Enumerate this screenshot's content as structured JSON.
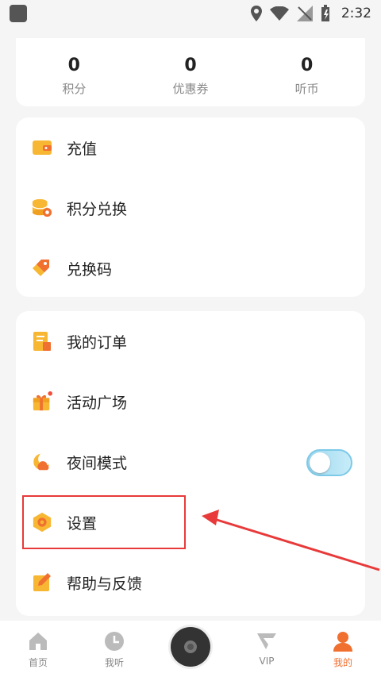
{
  "status_bar": {
    "time": "2:32"
  },
  "stats": [
    {
      "value": "0",
      "label": "积分"
    },
    {
      "value": "0",
      "label": "优惠券"
    },
    {
      "value": "0",
      "label": "听币"
    }
  ],
  "menu_group_1": [
    {
      "label": "充值",
      "icon": "wallet-icon"
    },
    {
      "label": "积分兑换",
      "icon": "coins-icon"
    },
    {
      "label": "兑换码",
      "icon": "tag-icon"
    }
  ],
  "menu_group_2": [
    {
      "label": "我的订单",
      "icon": "order-icon"
    },
    {
      "label": "活动广场",
      "icon": "gift-icon"
    },
    {
      "label": "夜间模式",
      "icon": "moon-icon"
    },
    {
      "label": "设置",
      "icon": "settings-icon"
    },
    {
      "label": "帮助与反馈",
      "icon": "edit-icon"
    }
  ],
  "night_mode": {
    "enabled": false
  },
  "bottom_nav": [
    {
      "label": "首页",
      "icon": "home-icon"
    },
    {
      "label": "我听",
      "icon": "clock-icon"
    },
    {
      "label": "",
      "icon": "disc-icon"
    },
    {
      "label": "VIP",
      "icon": "vip-icon"
    },
    {
      "label": "我的",
      "icon": "user-icon",
      "active": true
    }
  ],
  "colors": {
    "accent": "#f07030",
    "icon_yellow": "#f7b733",
    "highlight": "#e83a3a"
  }
}
